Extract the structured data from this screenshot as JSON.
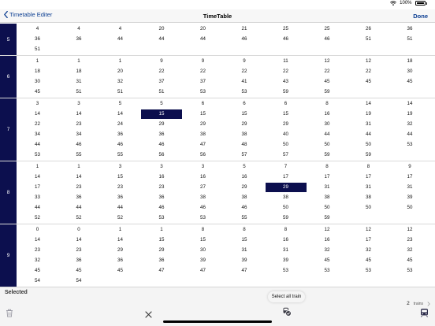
{
  "status_bar": {
    "battery_text": "100%"
  },
  "nav": {
    "back_label": "Timetable Editer",
    "title": "TimeTable",
    "done_label": "Done"
  },
  "hours": [
    {
      "hour": "5",
      "cells": [
        {
          "col": 0,
          "row": 0,
          "v": "4"
        },
        {
          "col": 1,
          "row": 0,
          "v": "4"
        },
        {
          "col": 2,
          "row": 0,
          "v": "4"
        },
        {
          "col": 3,
          "row": 0,
          "v": "20"
        },
        {
          "col": 4,
          "row": 0,
          "v": "20"
        },
        {
          "col": 5,
          "row": 0,
          "v": "21"
        },
        {
          "col": 6,
          "row": 0,
          "v": "25"
        },
        {
          "col": 7,
          "row": 0,
          "v": "25"
        },
        {
          "col": 8,
          "row": 0,
          "v": "26"
        },
        {
          "col": 9,
          "row": 0,
          "v": "36"
        },
        {
          "col": 0,
          "row": 1,
          "v": "36"
        },
        {
          "col": 1,
          "row": 1,
          "v": "36"
        },
        {
          "col": 2,
          "row": 1,
          "v": "44"
        },
        {
          "col": 3,
          "row": 1,
          "v": "44"
        },
        {
          "col": 4,
          "row": 1,
          "v": "44"
        },
        {
          "col": 5,
          "row": 1,
          "v": "46"
        },
        {
          "col": 6,
          "row": 1,
          "v": "46"
        },
        {
          "col": 7,
          "row": 1,
          "v": "46"
        },
        {
          "col": 8,
          "row": 1,
          "v": "51"
        },
        {
          "col": 9,
          "row": 1,
          "v": "51"
        },
        {
          "col": 0,
          "row": 2,
          "v": "51"
        }
      ]
    },
    {
      "hour": "6",
      "cells": [
        {
          "col": 0,
          "row": 0,
          "v": "1"
        },
        {
          "col": 1,
          "row": 0,
          "v": "1"
        },
        {
          "col": 2,
          "row": 0,
          "v": "1"
        },
        {
          "col": 3,
          "row": 0,
          "v": "9"
        },
        {
          "col": 4,
          "row": 0,
          "v": "9"
        },
        {
          "col": 5,
          "row": 0,
          "v": "9"
        },
        {
          "col": 6,
          "row": 0,
          "v": "11"
        },
        {
          "col": 7,
          "row": 0,
          "v": "12"
        },
        {
          "col": 8,
          "row": 0,
          "v": "12"
        },
        {
          "col": 9,
          "row": 0,
          "v": "18"
        },
        {
          "col": 0,
          "row": 1,
          "v": "18"
        },
        {
          "col": 1,
          "row": 1,
          "v": "18"
        },
        {
          "col": 2,
          "row": 1,
          "v": "20"
        },
        {
          "col": 3,
          "row": 1,
          "v": "22"
        },
        {
          "col": 4,
          "row": 1,
          "v": "22"
        },
        {
          "col": 5,
          "row": 1,
          "v": "22"
        },
        {
          "col": 6,
          "row": 1,
          "v": "22"
        },
        {
          "col": 7,
          "row": 1,
          "v": "22"
        },
        {
          "col": 8,
          "row": 1,
          "v": "22"
        },
        {
          "col": 9,
          "row": 1,
          "v": "30"
        },
        {
          "col": 0,
          "row": 2,
          "v": "30"
        },
        {
          "col": 1,
          "row": 2,
          "v": "31"
        },
        {
          "col": 2,
          "row": 2,
          "v": "32"
        },
        {
          "col": 3,
          "row": 2,
          "v": "37"
        },
        {
          "col": 4,
          "row": 2,
          "v": "37"
        },
        {
          "col": 5,
          "row": 2,
          "v": "41"
        },
        {
          "col": 6,
          "row": 2,
          "v": "43"
        },
        {
          "col": 7,
          "row": 2,
          "v": "45"
        },
        {
          "col": 8,
          "row": 2,
          "v": "45"
        },
        {
          "col": 9,
          "row": 2,
          "v": "45"
        },
        {
          "col": 0,
          "row": 3,
          "v": "45"
        },
        {
          "col": 1,
          "row": 3,
          "v": "51"
        },
        {
          "col": 2,
          "row": 3,
          "v": "51"
        },
        {
          "col": 3,
          "row": 3,
          "v": "51"
        },
        {
          "col": 4,
          "row": 3,
          "v": "53"
        },
        {
          "col": 5,
          "row": 3,
          "v": "53"
        },
        {
          "col": 6,
          "row": 3,
          "v": "59"
        },
        {
          "col": 7,
          "row": 3,
          "v": "59"
        }
      ]
    },
    {
      "hour": "7",
      "cells": [
        {
          "col": 0,
          "row": 0,
          "v": "3"
        },
        {
          "col": 1,
          "row": 0,
          "v": "3"
        },
        {
          "col": 2,
          "row": 0,
          "v": "5"
        },
        {
          "col": 3,
          "row": 0,
          "v": "5"
        },
        {
          "col": 4,
          "row": 0,
          "v": "6"
        },
        {
          "col": 5,
          "row": 0,
          "v": "6"
        },
        {
          "col": 6,
          "row": 0,
          "v": "6"
        },
        {
          "col": 7,
          "row": 0,
          "v": "8"
        },
        {
          "col": 8,
          "row": 0,
          "v": "14"
        },
        {
          "col": 9,
          "row": 0,
          "v": "14"
        },
        {
          "col": 0,
          "row": 1,
          "v": "14"
        },
        {
          "col": 1,
          "row": 1,
          "v": "14"
        },
        {
          "col": 2,
          "row": 1,
          "v": "14"
        },
        {
          "col": 3,
          "row": 1,
          "v": "15",
          "selected": true
        },
        {
          "col": 4,
          "row": 1,
          "v": "15"
        },
        {
          "col": 5,
          "row": 1,
          "v": "15"
        },
        {
          "col": 6,
          "row": 1,
          "v": "15"
        },
        {
          "col": 7,
          "row": 1,
          "v": "16"
        },
        {
          "col": 8,
          "row": 1,
          "v": "19"
        },
        {
          "col": 9,
          "row": 1,
          "v": "19"
        },
        {
          "col": 0,
          "row": 2,
          "v": "22"
        },
        {
          "col": 1,
          "row": 2,
          "v": "23"
        },
        {
          "col": 2,
          "row": 2,
          "v": "24"
        },
        {
          "col": 3,
          "row": 2,
          "v": "29"
        },
        {
          "col": 4,
          "row": 2,
          "v": "29"
        },
        {
          "col": 5,
          "row": 2,
          "v": "29"
        },
        {
          "col": 6,
          "row": 2,
          "v": "29"
        },
        {
          "col": 7,
          "row": 2,
          "v": "30"
        },
        {
          "col": 8,
          "row": 2,
          "v": "31"
        },
        {
          "col": 9,
          "row": 2,
          "v": "32"
        },
        {
          "col": 0,
          "row": 3,
          "v": "34"
        },
        {
          "col": 1,
          "row": 3,
          "v": "34"
        },
        {
          "col": 2,
          "row": 3,
          "v": "36"
        },
        {
          "col": 3,
          "row": 3,
          "v": "36"
        },
        {
          "col": 4,
          "row": 3,
          "v": "38"
        },
        {
          "col": 5,
          "row": 3,
          "v": "38"
        },
        {
          "col": 6,
          "row": 3,
          "v": "40"
        },
        {
          "col": 7,
          "row": 3,
          "v": "44"
        },
        {
          "col": 8,
          "row": 3,
          "v": "44"
        },
        {
          "col": 9,
          "row": 3,
          "v": "44"
        },
        {
          "col": 0,
          "row": 4,
          "v": "44"
        },
        {
          "col": 1,
          "row": 4,
          "v": "46"
        },
        {
          "col": 2,
          "row": 4,
          "v": "46"
        },
        {
          "col": 3,
          "row": 4,
          "v": "46"
        },
        {
          "col": 4,
          "row": 4,
          "v": "47"
        },
        {
          "col": 5,
          "row": 4,
          "v": "48"
        },
        {
          "col": 6,
          "row": 4,
          "v": "50"
        },
        {
          "col": 7,
          "row": 4,
          "v": "50"
        },
        {
          "col": 8,
          "row": 4,
          "v": "50"
        },
        {
          "col": 9,
          "row": 4,
          "v": "53"
        },
        {
          "col": 0,
          "row": 5,
          "v": "53"
        },
        {
          "col": 1,
          "row": 5,
          "v": "55"
        },
        {
          "col": 2,
          "row": 5,
          "v": "55"
        },
        {
          "col": 3,
          "row": 5,
          "v": "56"
        },
        {
          "col": 4,
          "row": 5,
          "v": "56"
        },
        {
          "col": 5,
          "row": 5,
          "v": "57"
        },
        {
          "col": 6,
          "row": 5,
          "v": "57"
        },
        {
          "col": 7,
          "row": 5,
          "v": "59"
        },
        {
          "col": 8,
          "row": 5,
          "v": "59"
        }
      ]
    },
    {
      "hour": "8",
      "cells": [
        {
          "col": 0,
          "row": 0,
          "v": "1"
        },
        {
          "col": 1,
          "row": 0,
          "v": "1"
        },
        {
          "col": 2,
          "row": 0,
          "v": "3"
        },
        {
          "col": 3,
          "row": 0,
          "v": "3"
        },
        {
          "col": 4,
          "row": 0,
          "v": "3"
        },
        {
          "col": 5,
          "row": 0,
          "v": "5"
        },
        {
          "col": 6,
          "row": 0,
          "v": "7"
        },
        {
          "col": 7,
          "row": 0,
          "v": "8"
        },
        {
          "col": 8,
          "row": 0,
          "v": "8"
        },
        {
          "col": 9,
          "row": 0,
          "v": "9"
        },
        {
          "col": 0,
          "row": 1,
          "v": "14"
        },
        {
          "col": 1,
          "row": 1,
          "v": "14"
        },
        {
          "col": 2,
          "row": 1,
          "v": "15"
        },
        {
          "col": 3,
          "row": 1,
          "v": "16"
        },
        {
          "col": 4,
          "row": 1,
          "v": "16"
        },
        {
          "col": 5,
          "row": 1,
          "v": "16"
        },
        {
          "col": 6,
          "row": 1,
          "v": "17"
        },
        {
          "col": 7,
          "row": 1,
          "v": "17"
        },
        {
          "col": 8,
          "row": 1,
          "v": "17"
        },
        {
          "col": 9,
          "row": 1,
          "v": "17"
        },
        {
          "col": 0,
          "row": 2,
          "v": "17"
        },
        {
          "col": 1,
          "row": 2,
          "v": "23"
        },
        {
          "col": 2,
          "row": 2,
          "v": "23"
        },
        {
          "col": 3,
          "row": 2,
          "v": "23"
        },
        {
          "col": 4,
          "row": 2,
          "v": "27"
        },
        {
          "col": 5,
          "row": 2,
          "v": "29"
        },
        {
          "col": 6,
          "row": 2,
          "v": "29",
          "selected": true
        },
        {
          "col": 7,
          "row": 2,
          "v": "31"
        },
        {
          "col": 8,
          "row": 2,
          "v": "31"
        },
        {
          "col": 9,
          "row": 2,
          "v": "31"
        },
        {
          "col": 0,
          "row": 3,
          "v": "33"
        },
        {
          "col": 1,
          "row": 3,
          "v": "36"
        },
        {
          "col": 2,
          "row": 3,
          "v": "36"
        },
        {
          "col": 3,
          "row": 3,
          "v": "36"
        },
        {
          "col": 4,
          "row": 3,
          "v": "38"
        },
        {
          "col": 5,
          "row": 3,
          "v": "38"
        },
        {
          "col": 6,
          "row": 3,
          "v": "38"
        },
        {
          "col": 7,
          "row": 3,
          "v": "38"
        },
        {
          "col": 8,
          "row": 3,
          "v": "38"
        },
        {
          "col": 9,
          "row": 3,
          "v": "39"
        },
        {
          "col": 0,
          "row": 4,
          "v": "44"
        },
        {
          "col": 1,
          "row": 4,
          "v": "44"
        },
        {
          "col": 2,
          "row": 4,
          "v": "44"
        },
        {
          "col": 3,
          "row": 4,
          "v": "46"
        },
        {
          "col": 4,
          "row": 4,
          "v": "46"
        },
        {
          "col": 5,
          "row": 4,
          "v": "46"
        },
        {
          "col": 6,
          "row": 4,
          "v": "50"
        },
        {
          "col": 7,
          "row": 4,
          "v": "50"
        },
        {
          "col": 8,
          "row": 4,
          "v": "50"
        },
        {
          "col": 9,
          "row": 4,
          "v": "50"
        },
        {
          "col": 0,
          "row": 5,
          "v": "52"
        },
        {
          "col": 1,
          "row": 5,
          "v": "52"
        },
        {
          "col": 2,
          "row": 5,
          "v": "52"
        },
        {
          "col": 3,
          "row": 5,
          "v": "53"
        },
        {
          "col": 4,
          "row": 5,
          "v": "53"
        },
        {
          "col": 5,
          "row": 5,
          "v": "55"
        },
        {
          "col": 6,
          "row": 5,
          "v": "59"
        },
        {
          "col": 7,
          "row": 5,
          "v": "59"
        }
      ]
    },
    {
      "hour": "9",
      "cells": [
        {
          "col": 0,
          "row": 0,
          "v": "0"
        },
        {
          "col": 1,
          "row": 0,
          "v": "0"
        },
        {
          "col": 2,
          "row": 0,
          "v": "1"
        },
        {
          "col": 3,
          "row": 0,
          "v": "1"
        },
        {
          "col": 4,
          "row": 0,
          "v": "8"
        },
        {
          "col": 5,
          "row": 0,
          "v": "8"
        },
        {
          "col": 6,
          "row": 0,
          "v": "8"
        },
        {
          "col": 7,
          "row": 0,
          "v": "12"
        },
        {
          "col": 8,
          "row": 0,
          "v": "12"
        },
        {
          "col": 9,
          "row": 0,
          "v": "12"
        },
        {
          "col": 0,
          "row": 1,
          "v": "14"
        },
        {
          "col": 1,
          "row": 1,
          "v": "14"
        },
        {
          "col": 2,
          "row": 1,
          "v": "14"
        },
        {
          "col": 3,
          "row": 1,
          "v": "15"
        },
        {
          "col": 4,
          "row": 1,
          "v": "15"
        },
        {
          "col": 5,
          "row": 1,
          "v": "15"
        },
        {
          "col": 6,
          "row": 1,
          "v": "16"
        },
        {
          "col": 7,
          "row": 1,
          "v": "16"
        },
        {
          "col": 8,
          "row": 1,
          "v": "17"
        },
        {
          "col": 9,
          "row": 1,
          "v": "23"
        },
        {
          "col": 0,
          "row": 2,
          "v": "23"
        },
        {
          "col": 1,
          "row": 2,
          "v": "23"
        },
        {
          "col": 2,
          "row": 2,
          "v": "29"
        },
        {
          "col": 3,
          "row": 2,
          "v": "29"
        },
        {
          "col": 4,
          "row": 2,
          "v": "30"
        },
        {
          "col": 5,
          "row": 2,
          "v": "31"
        },
        {
          "col": 6,
          "row": 2,
          "v": "31"
        },
        {
          "col": 7,
          "row": 2,
          "v": "32"
        },
        {
          "col": 8,
          "row": 2,
          "v": "32"
        },
        {
          "col": 9,
          "row": 2,
          "v": "32"
        },
        {
          "col": 0,
          "row": 3,
          "v": "32"
        },
        {
          "col": 1,
          "row": 3,
          "v": "36"
        },
        {
          "col": 2,
          "row": 3,
          "v": "36"
        },
        {
          "col": 3,
          "row": 3,
          "v": "36"
        },
        {
          "col": 4,
          "row": 3,
          "v": "39"
        },
        {
          "col": 5,
          "row": 3,
          "v": "39"
        },
        {
          "col": 6,
          "row": 3,
          "v": "39"
        },
        {
          "col": 7,
          "row": 3,
          "v": "45"
        },
        {
          "col": 8,
          "row": 3,
          "v": "45"
        },
        {
          "col": 9,
          "row": 3,
          "v": "45"
        },
        {
          "col": 0,
          "row": 4,
          "v": "45"
        },
        {
          "col": 1,
          "row": 4,
          "v": "45"
        },
        {
          "col": 2,
          "row": 4,
          "v": "45"
        },
        {
          "col": 3,
          "row": 4,
          "v": "47"
        },
        {
          "col": 4,
          "row": 4,
          "v": "47"
        },
        {
          "col": 5,
          "row": 4,
          "v": "47"
        },
        {
          "col": 6,
          "row": 4,
          "v": "53"
        },
        {
          "col": 7,
          "row": 4,
          "v": "53"
        },
        {
          "col": 8,
          "row": 4,
          "v": "53"
        },
        {
          "col": 9,
          "row": 4,
          "v": "53"
        },
        {
          "col": 0,
          "row": 5,
          "v": "54"
        },
        {
          "col": 1,
          "row": 5,
          "v": "54"
        }
      ]
    }
  ],
  "footer": {
    "selected_label": "Selected",
    "tooltip": "Select all train",
    "trains_count": "2",
    "trains_label": "trains"
  },
  "icons": {
    "back": "chevron-left-icon",
    "trash": "trash-icon",
    "clear": "close-icon",
    "select_all": "select-all-train-icon",
    "train": "train-icon"
  },
  "colors": {
    "accent": "#0c0f4e",
    "link": "#0a3d91",
    "footer_bg": "#f4f4f4"
  }
}
